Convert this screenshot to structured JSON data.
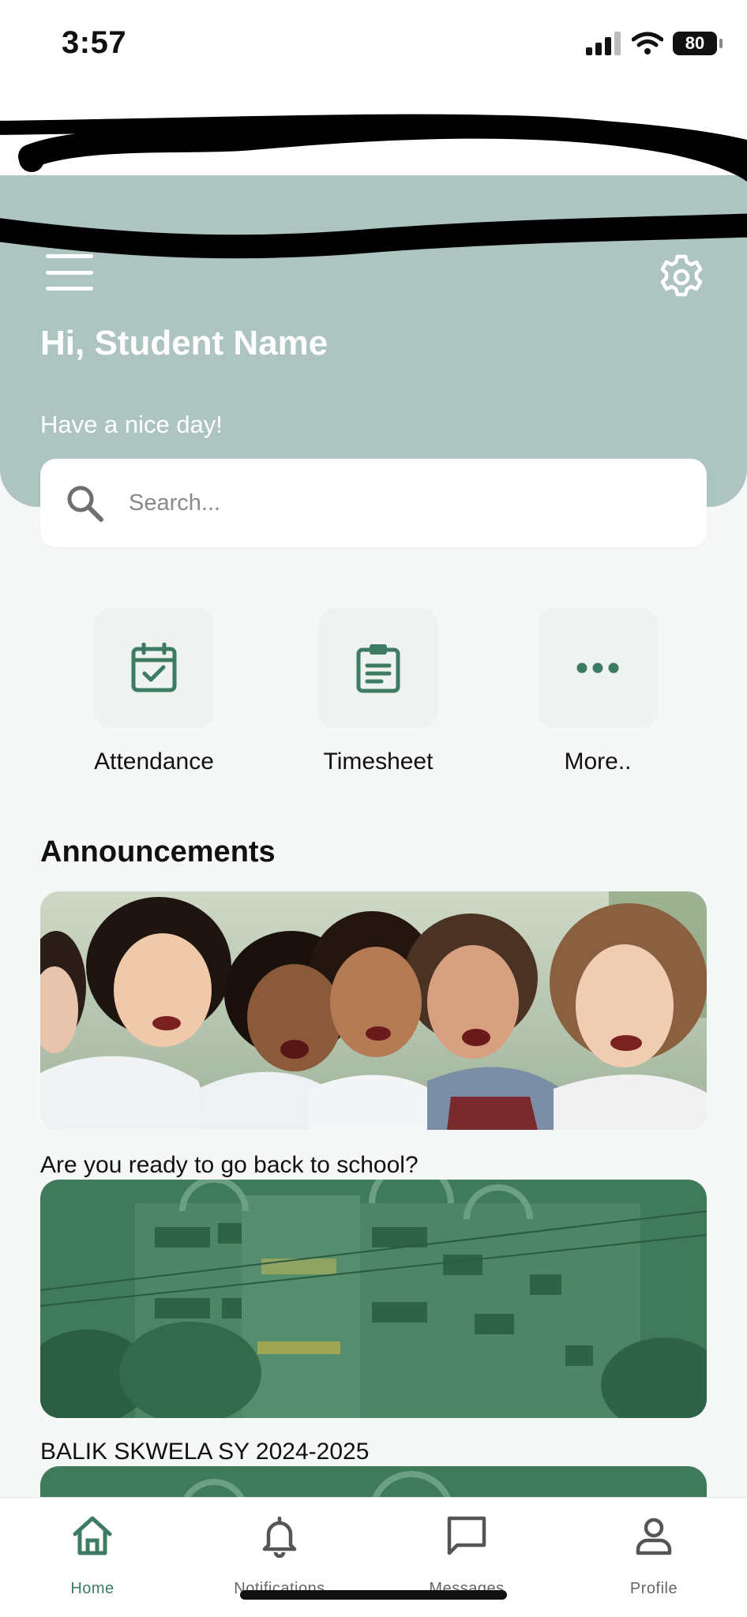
{
  "status_bar": {
    "time": "3:57",
    "battery": "80"
  },
  "nav": {
    "title": "Home"
  },
  "header": {
    "greeting": "Hi, Student Name",
    "sub_greeting": "Have a nice day!"
  },
  "search": {
    "placeholder": "Search..."
  },
  "quick_actions": [
    {
      "label": "Attendance",
      "icon": "calendar-check-icon"
    },
    {
      "label": "Timesheet",
      "icon": "clipboard-icon"
    },
    {
      "label": "More..",
      "icon": "more-dots-icon"
    }
  ],
  "announcements": {
    "title": "Announcements",
    "items": [
      {
        "caption": "Are you ready to go back to school?"
      },
      {
        "caption": "BALIK SKWELA SY 2024-2025"
      }
    ]
  },
  "bottom_nav": [
    {
      "label": "Home",
      "icon": "home-icon",
      "active": true
    },
    {
      "label": "Notifications",
      "icon": "bell-icon",
      "active": false
    },
    {
      "label": "Messages",
      "icon": "message-icon",
      "active": false
    },
    {
      "label": "Profile",
      "icon": "user-icon",
      "active": false
    }
  ],
  "colors": {
    "accent": "#3e7b63",
    "header_bg": "#aec4c1",
    "tile_bg": "#eef2f1",
    "page_bg": "#f6f7f7"
  }
}
